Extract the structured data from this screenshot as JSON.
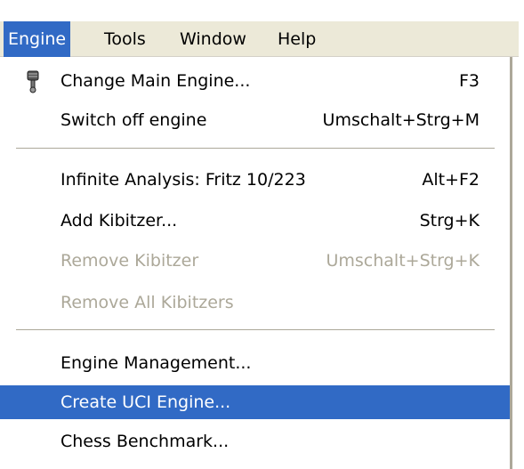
{
  "menubar": {
    "menus": [
      "Engine",
      "Tools",
      "Window",
      "Help"
    ],
    "active_menu": "Engine"
  },
  "engine_menu": {
    "items": [
      {
        "label": "Change Main Engine...",
        "shortcut": "F3",
        "icon": "engine-piston-icon",
        "enabled": true
      },
      {
        "label": "Switch off engine",
        "shortcut": "Umschalt+Strg+M",
        "enabled": true
      },
      {
        "label": "Infinite Analysis: Fritz 10/223",
        "shortcut": "Alt+F2",
        "enabled": true
      },
      {
        "label": "Add Kibitzer...",
        "shortcut": "Strg+K",
        "enabled": true
      },
      {
        "label": "Remove Kibitzer",
        "shortcut": "Umschalt+Strg+K",
        "enabled": false
      },
      {
        "label": "Remove All Kibitzers",
        "shortcut": "",
        "enabled": false
      },
      {
        "label": "Engine Management...",
        "shortcut": "",
        "enabled": true
      },
      {
        "label": "Create UCI Engine...",
        "shortcut": "",
        "enabled": true,
        "selected": true
      },
      {
        "label": "Chess Benchmark...",
        "shortcut": "",
        "enabled": true
      }
    ]
  },
  "colors": {
    "highlight": "#316ac5",
    "highlight_text": "#ffffff",
    "disabled_text": "#aca899",
    "menubar_bg": "#ece9d8"
  }
}
